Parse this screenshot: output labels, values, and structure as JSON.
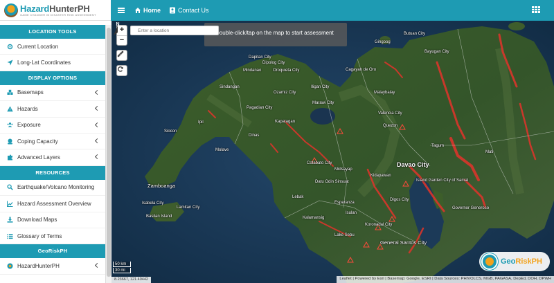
{
  "brand": {
    "name_part1": "Hazard",
    "name_part2": "HunterPH",
    "tagline": "GAME CHANGER IN DISASTER RISK ASSESSMENT"
  },
  "topnav": {
    "home_label": "Home",
    "contact_label": "Contact Us"
  },
  "sidebar": {
    "location_tools": {
      "title": "LOCATION TOOLS",
      "items": [
        "Current Location",
        "Long-Lat Coordinates"
      ]
    },
    "display_options": {
      "title": "DISPLAY OPTIONS",
      "items": [
        "Basemaps",
        "Hazards",
        "Exposure",
        "Coping Capacity",
        "Advanced Layers"
      ]
    },
    "resources": {
      "title": "RESOURCES",
      "items": [
        "Earthquake/Volcano Monitoring",
        "Hazard Assessment Overview",
        "Download Maps",
        "Glossary of Terms"
      ]
    },
    "georiskph": {
      "title": "GeoRiskPH",
      "items": [
        "HazardHunterPH"
      ]
    }
  },
  "map": {
    "search_placeholder": "Enter a location",
    "instruction": "Double-click/tap on the map to start assessment",
    "zoom_in": "+",
    "zoom_out": "−",
    "scale_km": "50 km",
    "scale_mi": "30 mi",
    "coordinates": "8.23667, 121.40442",
    "attribution": "Leaflet | Powered by Esri | Basemap: Google, ESRI | Data Sources: PHIVOLCS, MGB, PAGASA, DepEd, DOH, DPWH",
    "places": {
      "dapitan": "Dapitan City",
      "dipolog": "Dipolog City",
      "mindanao_lbl": "Mindanao",
      "oroquieta": "Oroquieta City",
      "sindangan": "Sindangan",
      "ozamiz": "Ozamiz City",
      "iligan": "Iligan City",
      "cdo": "Cagayan de Oro",
      "malaybalay": "Malaybalay",
      "marawi": "Marawi City",
      "pagadian": "Pagadian City",
      "kapatagan": "Kapatagan",
      "valencia": "Valencia City",
      "quezon": "Quezon",
      "ipil": "Ipil",
      "siocon": "Siocon",
      "dinas": "Dinas",
      "molave": "Molave",
      "cotabato": "Cotabato City",
      "midsayap": "Midsayap",
      "davao": "Davao City",
      "tagum": "Tagum",
      "kidapawan": "Kidapawan",
      "zamboanga": "Zamboanga",
      "isabela": "Isabela City",
      "lamitan": "Lamitan City",
      "basilan": "Basilan Island",
      "butuan": "Butuan City",
      "bayugan": "Bayugan City",
      "gingoog": "Gingoog",
      "mati": "Mati",
      "samal": "Island Garden City of Samal",
      "digos": "Digos City",
      "esperanza": "Esperanza",
      "lebak": "Lebak",
      "isulan": "Isulan",
      "koronadal": "Koronadal City",
      "gensan": "General Santos City",
      "governor_generoso": "Governor Generoso",
      "kalamansig": "Kalamansig",
      "lake_sebu": "Lake Sebu",
      "datu_odin": "Datu Odin Sinsuat"
    }
  },
  "partner": {
    "name_part1": "Geo",
    "name_part2": "RiskPH"
  },
  "colors": {
    "accent": "#1e9bb3",
    "accent_orange": "#f2a21b",
    "hazard_red": "#d9352b"
  }
}
